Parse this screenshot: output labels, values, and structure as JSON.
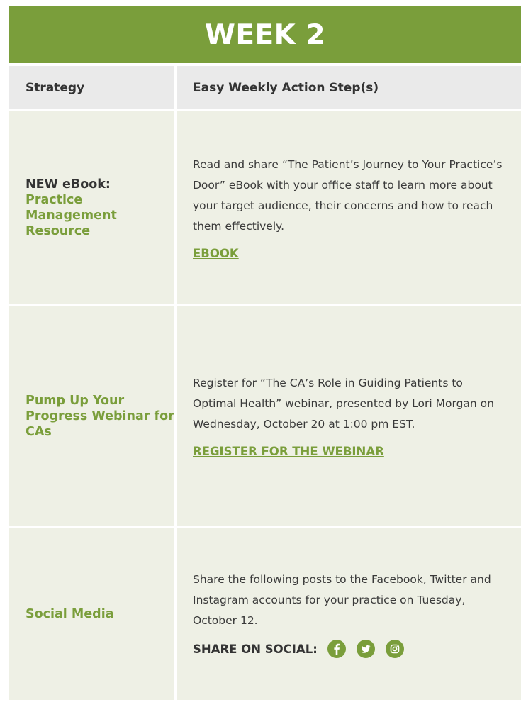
{
  "header": {
    "title": "WEEK 2"
  },
  "table": {
    "headers": {
      "strategy": "Strategy",
      "action": "Easy Weekly Action Step(s)"
    },
    "rows": [
      {
        "strategy_prefix": "NEW eBook:",
        "strategy": "Practice Management Resource",
        "description": "Read and share “The Patient’s Journey to Your Practice’s Door” eBook with your office staff to learn more about your target audience, their concerns and how to reach them effectively.",
        "link": "EBOOK"
      },
      {
        "strategy": "Pump Up Your Progress Webinar for CAs",
        "description": "Register for “The CA’s Role in Guiding Patients to Optimal Health” webinar, presented by Lori Morgan on Wednesday, October 20 at 1:00 pm EST.",
        "link": "REGISTER FOR THE WEBINAR"
      },
      {
        "strategy": "Social Media",
        "description": "Share the following posts to the Facebook, Twitter and Instagram accounts for your practice on Tuesday, October 12.",
        "share_label": "SHARE ON SOCIAL:",
        "icons": [
          "facebook-icon",
          "twitter-icon",
          "instagram-icon"
        ]
      }
    ]
  },
  "colors": {
    "brand_green": "#7a9e3b",
    "header_row_bg": "#eaeaea",
    "body_row_bg": "#eef0e5",
    "text_dark": "#333333"
  }
}
